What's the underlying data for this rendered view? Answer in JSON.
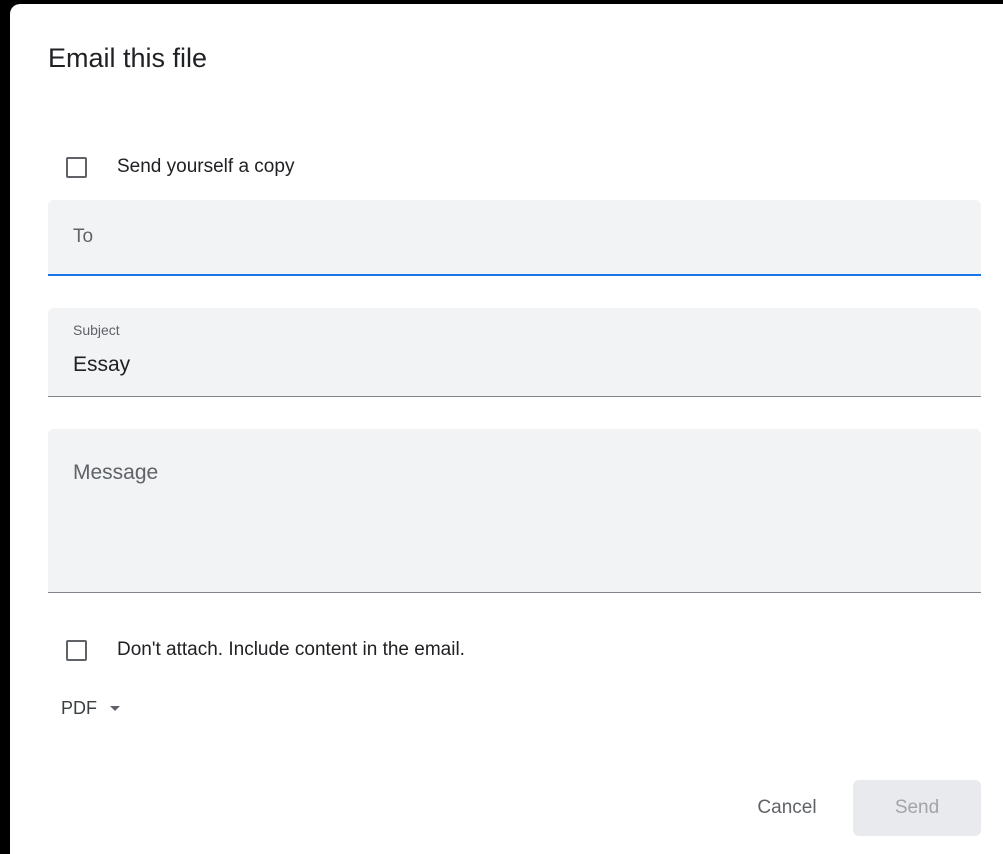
{
  "dialog": {
    "title": "Email this file",
    "send_copy_label": "Send yourself a copy",
    "to": {
      "placeholder": "To",
      "value": ""
    },
    "subject": {
      "label": "Subject",
      "value": "Essay"
    },
    "message": {
      "placeholder": "Message",
      "value": ""
    },
    "dont_attach_label": "Don't attach. Include content in the email.",
    "format": {
      "selected": "PDF"
    },
    "cancel_label": "Cancel",
    "send_label": "Send"
  },
  "colors": {
    "focus_underline": "#1a73e8",
    "field_background": "#f1f3f4",
    "disabled_button": "#e8eaed"
  },
  "icons": {
    "dropdown": "caret-down-icon"
  }
}
